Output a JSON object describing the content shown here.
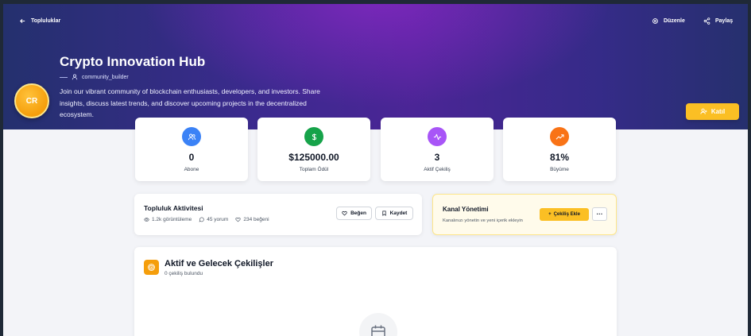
{
  "nav": {
    "back_label": "Topluluklar",
    "edit_label": "Düzenle",
    "share_label": "Paylaş"
  },
  "community": {
    "title": "Crypto Innovation Hub",
    "creator": "community_builder",
    "description": "Join our vibrant community of blockchain enthusiasts, developers, and investors. Share insights, discuss latest trends, and discover upcoming projects in the decentralized ecosystem.",
    "avatar_initials": "CR",
    "join_label": "Katıl"
  },
  "stats": [
    {
      "value": "0",
      "label": "Abone",
      "icon": "users-icon",
      "color": "#3b82f6"
    },
    {
      "value": "$125000.00",
      "label": "Toplam Ödül",
      "icon": "dollar-icon",
      "color": "#16a34a"
    },
    {
      "value": "3",
      "label": "Aktif Çekiliş",
      "icon": "activity-icon",
      "color": "#a855f7"
    },
    {
      "value": "81%",
      "label": "Büyüme",
      "icon": "trending-up-icon",
      "color": "#f97316"
    }
  ],
  "activity": {
    "title": "Topluluk Aktivitesi",
    "views": "1.2k görüntüleme",
    "comments": "45 yorum",
    "likes": "234 beğeni",
    "like_label": "Beğen",
    "save_label": "Kaydet"
  },
  "channel": {
    "title": "Kanal Yönetimi",
    "subtitle": "Kanalınızı yönetin ve yeni içerik ekleyin",
    "add_label": "Çekiliş Ekle",
    "more_label": "···"
  },
  "giveaways": {
    "title": "Aktif ve Gelecek Çekilişler",
    "count_text": "0 çekiliş bulundu"
  },
  "colors": {
    "accent": "#fbbf24",
    "hero_start": "#24306e",
    "hero_mid": "#4b2596"
  }
}
